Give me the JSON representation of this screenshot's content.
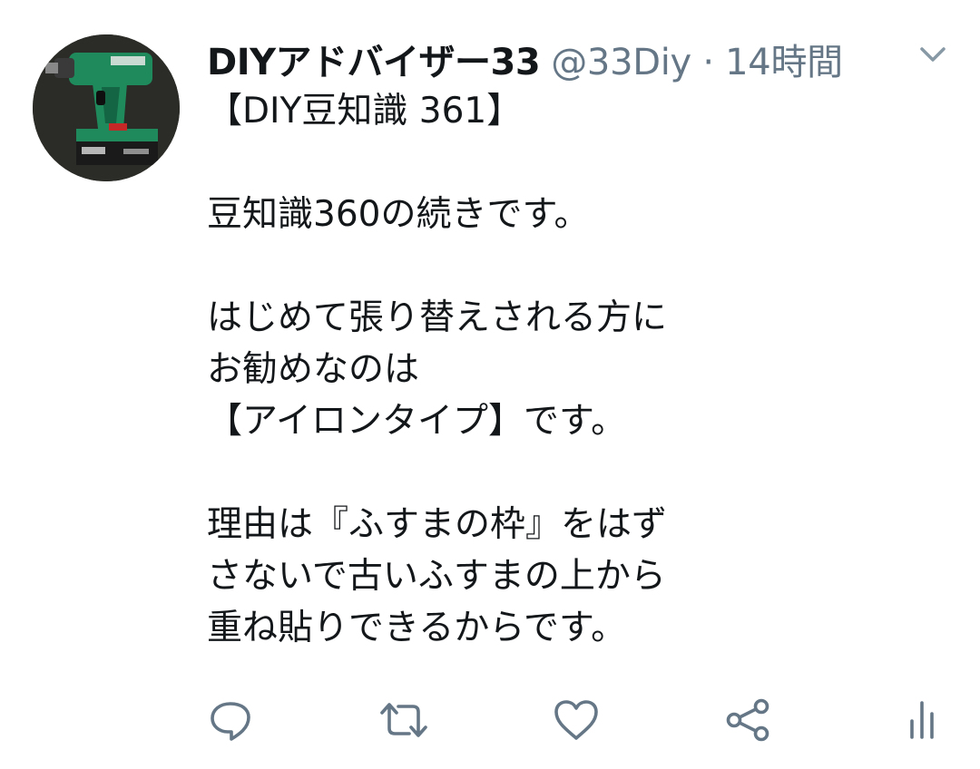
{
  "tweet": {
    "display_name": "DIYアドバイザー33",
    "meta": "@33Diy · 14時間",
    "text": "【DIY豆知識 361】\n\n豆知識360の続きです。\n\nはじめて張り替えされる方に\nお勧めなのは\n【アイロンタイプ】です。\n\n理由は『ふすまの枠』をはず\nさないで古いふすまの上から\n重ね貼りできるからです。"
  },
  "avatar": {
    "icon": "drill-avatar-icon",
    "colors": {
      "background": "#2b2b27",
      "tool_body": "#1f8a5b",
      "battery": "#1a1a1a",
      "accent": "#c62828"
    }
  },
  "menu": {
    "icon": "chevron-down-icon",
    "color": "#8899a6"
  },
  "actions": {
    "icons": [
      "reply-icon",
      "retweet-icon",
      "like-icon",
      "share-icon",
      "analytics-icon"
    ],
    "color": "#657786"
  }
}
